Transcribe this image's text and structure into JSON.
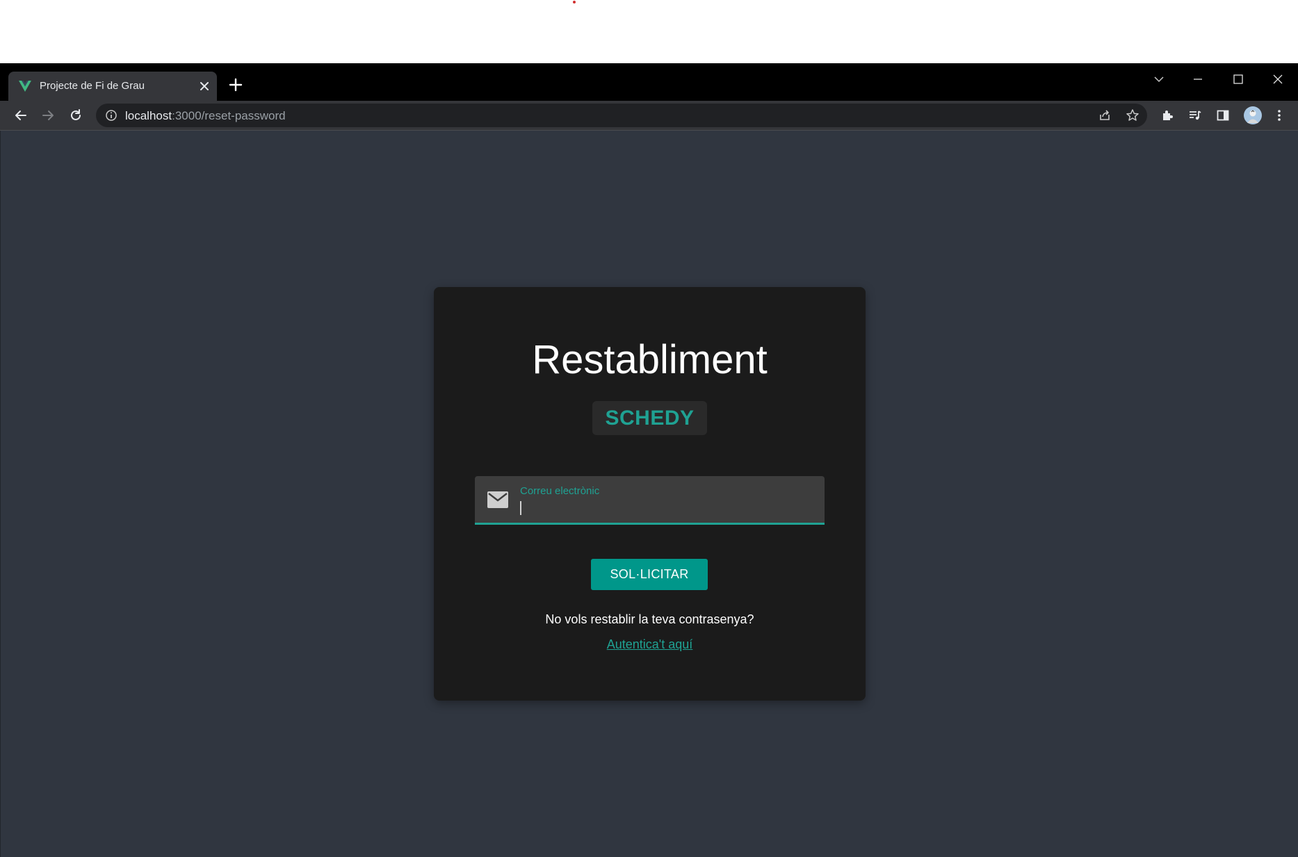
{
  "browser": {
    "tab_title": "Projecte de Fi de Grau",
    "url_host": "localhost",
    "url_rest": ":3000/reset-password"
  },
  "card": {
    "title": "Restabliment",
    "brand": "SCHEDY",
    "email_label": "Correu electrònic",
    "email_value": "",
    "submit_label": "SOL·LICITAR",
    "question": "No vols restablir la teva contrasenya?",
    "login_link": "Autentica't aquí"
  },
  "colors": {
    "accent": "#1fa293",
    "button": "#00978a",
    "page_bg": "#303640",
    "card_bg": "#1b1b1b"
  },
  "icons": {
    "favicon": "vue-logo-icon",
    "field": "mail-icon"
  }
}
